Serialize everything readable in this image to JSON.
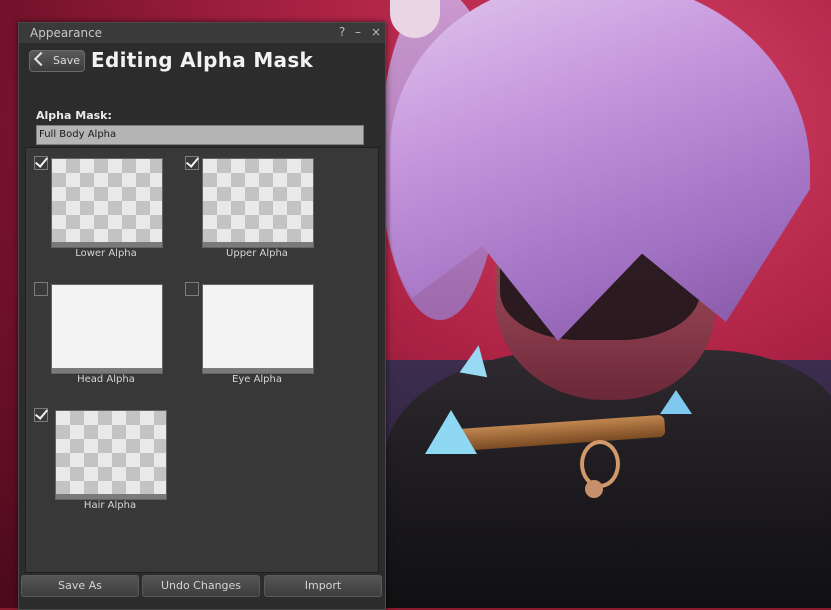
{
  "window": {
    "title": "Appearance",
    "controls": {
      "help": "?",
      "minimize": "–",
      "close": "×"
    }
  },
  "header": {
    "back_label": "Save",
    "heading": "Editing Alpha Mask"
  },
  "alpha_mask": {
    "label": "Alpha Mask:",
    "value": "Full Body Alpha"
  },
  "items": [
    {
      "label": "Lower Alpha",
      "checked": true,
      "texture": "checker"
    },
    {
      "label": "Upper Alpha",
      "checked": true,
      "texture": "checker"
    },
    {
      "label": "Head Alpha",
      "checked": false,
      "texture": "blank"
    },
    {
      "label": "Eye Alpha",
      "checked": false,
      "texture": "blank"
    },
    {
      "label": "Hair Alpha",
      "checked": true,
      "texture": "checker"
    }
  ],
  "footer": {
    "save_as": "Save As",
    "undo": "Undo Changes",
    "import": "Import"
  }
}
